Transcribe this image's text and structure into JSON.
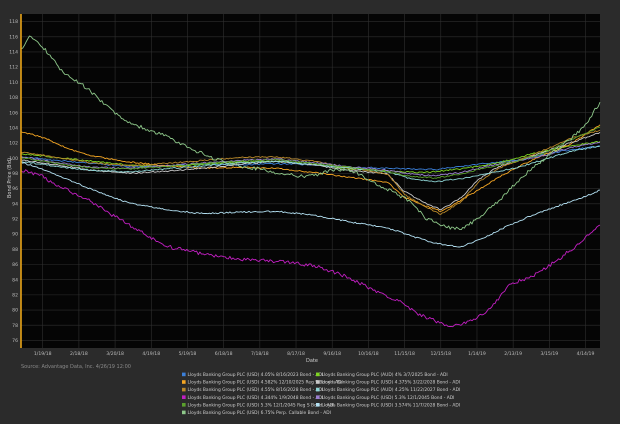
{
  "chart_data": {
    "type": "line",
    "xlabel": "Date",
    "ylabel": "Bond Price (Bid)",
    "source": "Source: Advantage Data, Inc. 4/26/19 12:00",
    "x_start": "2018-01-01",
    "x_end": "2019-04-26",
    "x_ticks": [
      {
        "date": "2018-01-19",
        "label": "1/19/18"
      },
      {
        "date": "2018-02-18",
        "label": "2/18/18"
      },
      {
        "date": "2018-03-20",
        "label": "3/20/18"
      },
      {
        "date": "2018-04-19",
        "label": "4/19/18"
      },
      {
        "date": "2018-05-19",
        "label": "5/19/18"
      },
      {
        "date": "2018-06-18",
        "label": "6/18/18"
      },
      {
        "date": "2018-07-18",
        "label": "7/18/18"
      },
      {
        "date": "2018-08-17",
        "label": "8/17/18"
      },
      {
        "date": "2018-09-16",
        "label": "9/16/18"
      },
      {
        "date": "2018-10-16",
        "label": "10/16/18"
      },
      {
        "date": "2018-11-15",
        "label": "11/15/18"
      },
      {
        "date": "2018-12-15",
        "label": "12/15/18"
      },
      {
        "date": "2019-01-14",
        "label": "1/14/19"
      },
      {
        "date": "2019-02-13",
        "label": "2/13/19"
      },
      {
        "date": "2019-03-15",
        "label": "3/15/19"
      },
      {
        "date": "2019-04-14",
        "label": "4/14/19"
      }
    ],
    "ylim": [
      75,
      119
    ],
    "y_ticks": [
      76,
      78,
      80,
      82,
      84,
      86,
      88,
      90,
      92,
      94,
      96,
      98,
      100,
      102,
      104,
      106,
      108,
      110,
      112,
      114,
      116,
      118
    ],
    "grid": true,
    "legend_position": "bottom",
    "series": [
      {
        "name": "Lloyds Banking Group PLC (USD) 4.05% 8/16/2023 Bond - ADI",
        "color": "#3b7fd9",
        "x": [
          "2018-01-01",
          "2018-02-01",
          "2018-03-01",
          "2018-04-01",
          "2018-05-01",
          "2018-06-01",
          "2018-07-01",
          "2018-08-01",
          "2018-09-01",
          "2018-10-01",
          "2018-11-01",
          "2018-11-20",
          "2018-12-10",
          "2018-12-31",
          "2019-01-20",
          "2019-02-15",
          "2019-03-10",
          "2019-04-01",
          "2019-04-26"
        ],
        "y": [
          100.2,
          99.7,
          99.3,
          98.9,
          99.0,
          99.2,
          99.1,
          99.3,
          99.1,
          98.8,
          98.7,
          98.6,
          98.5,
          98.9,
          99.3,
          99.7,
          100.5,
          101.1,
          101.6
        ]
      },
      {
        "name": "Lloyds Banking Group PLC (AUD) 4% 3/7/2025 Bond - ADI",
        "color": "#7ed321",
        "x": [
          "2018-01-01",
          "2018-02-01",
          "2018-03-01",
          "2018-04-01",
          "2018-05-01",
          "2018-06-01",
          "2018-07-01",
          "2018-08-01",
          "2018-09-01",
          "2018-10-01",
          "2018-11-01",
          "2018-12-01",
          "2019-01-01",
          "2019-02-01",
          "2019-03-01",
          "2019-04-01",
          "2019-04-26"
        ],
        "y": [
          100.6,
          100.1,
          99.6,
          99.1,
          98.9,
          99.2,
          99.5,
          99.6,
          99.2,
          98.6,
          98.3,
          98.1,
          98.6,
          99.4,
          100.6,
          101.6,
          102.2
        ]
      },
      {
        "name": "Lloyds Banking Group PLC (USD) 4.582% 12/10/2025 Reg S Bond - ADI",
        "color": "#f5a623",
        "x": [
          "2018-01-01",
          "2018-01-20",
          "2018-02-10",
          "2018-03-01",
          "2018-04-01",
          "2018-05-01",
          "2018-06-01",
          "2018-07-01",
          "2018-08-01",
          "2018-09-01",
          "2018-10-01",
          "2018-11-01",
          "2018-11-15",
          "2018-12-01",
          "2018-12-15",
          "2019-01-01",
          "2019-01-15",
          "2019-02-01",
          "2019-03-01",
          "2019-04-01",
          "2019-04-26"
        ],
        "y": [
          103.5,
          102.7,
          101.2,
          100.3,
          99.5,
          99.0,
          98.7,
          98.8,
          98.7,
          98.1,
          97.5,
          96.8,
          94.8,
          93.8,
          93.0,
          94.5,
          95.8,
          97.5,
          99.8,
          101.8,
          104.4
        ]
      },
      {
        "name": "Lloyds Banking Group PLC (USD) 4.375% 3/22/2028 Bond - ADI",
        "color": "#c9c9c9",
        "x": [
          "2018-01-01",
          "2018-02-01",
          "2018-03-01",
          "2018-04-01",
          "2018-05-01",
          "2018-06-01",
          "2018-07-01",
          "2018-08-01",
          "2018-09-01",
          "2018-10-01",
          "2018-11-01",
          "2018-11-15",
          "2018-12-01",
          "2018-12-15",
          "2019-01-01",
          "2019-01-15",
          "2019-02-01",
          "2019-03-01",
          "2019-04-01",
          "2019-04-26"
        ],
        "y": [
          99.8,
          99.1,
          98.4,
          98.0,
          98.3,
          98.7,
          99.2,
          99.6,
          99.1,
          98.4,
          97.9,
          95.6,
          94.2,
          93.2,
          94.8,
          97.2,
          98.9,
          100.3,
          102.0,
          103.4
        ]
      },
      {
        "name": "Lloyds Banking Group PLC (USD) 4.55% 8/16/2028 Bond - ADI",
        "color": "#b8882a",
        "x": [
          "2018-01-01",
          "2018-02-01",
          "2018-03-01",
          "2018-04-01",
          "2018-05-01",
          "2018-06-01",
          "2018-07-01",
          "2018-08-01",
          "2018-09-01",
          "2018-10-01",
          "2018-11-01",
          "2018-11-15",
          "2018-12-01",
          "2018-12-15",
          "2019-01-01",
          "2019-01-15",
          "2019-02-01",
          "2019-03-01",
          "2019-04-01",
          "2019-04-26"
        ],
        "y": [
          100.8,
          100.1,
          99.4,
          99.0,
          99.3,
          99.7,
          100.1,
          100.2,
          99.6,
          98.7,
          97.9,
          95.2,
          93.7,
          92.6,
          94.3,
          96.8,
          98.7,
          100.4,
          102.6,
          103.7
        ]
      },
      {
        "name": "Lloyds Banking Group PLC (AUD) 4.25% 11/22/2027 Bond - ADI",
        "color": "#8fd6d6",
        "x": [
          "2018-01-01",
          "2018-02-01",
          "2018-03-01",
          "2018-04-01",
          "2018-05-01",
          "2018-06-01",
          "2018-07-01",
          "2018-08-01",
          "2018-09-01",
          "2018-10-01",
          "2018-11-01",
          "2018-11-20",
          "2018-12-10",
          "2018-12-31",
          "2019-01-20",
          "2019-02-15",
          "2019-03-10",
          "2019-04-01",
          "2019-04-26"
        ],
        "y": [
          99.6,
          98.9,
          98.4,
          98.2,
          98.6,
          99.0,
          99.4,
          99.6,
          99.2,
          98.7,
          98.2,
          97.3,
          96.9,
          97.3,
          97.9,
          98.7,
          99.8,
          100.9,
          101.6
        ]
      },
      {
        "name": "Lloyds Banking Group PLC (USD) 4.344% 1/9/2048 Bond - ADI",
        "color": "#c21fc2",
        "x": [
          "2018-01-01",
          "2018-01-15",
          "2018-02-01",
          "2018-03-01",
          "2018-03-20",
          "2018-04-10",
          "2018-05-01",
          "2018-06-01",
          "2018-07-01",
          "2018-08-01",
          "2018-09-01",
          "2018-10-01",
          "2018-10-20",
          "2018-11-10",
          "2018-11-25",
          "2018-12-10",
          "2018-12-25",
          "2019-01-10",
          "2019-01-25",
          "2019-02-10",
          "2019-03-01",
          "2019-03-20",
          "2019-04-10",
          "2019-04-26"
        ],
        "y": [
          98.4,
          97.9,
          96.4,
          94.2,
          92.3,
          90.4,
          88.4,
          87.4,
          86.7,
          86.4,
          85.9,
          84.2,
          82.6,
          81.2,
          79.6,
          78.6,
          77.8,
          78.6,
          80.2,
          83.4,
          84.4,
          86.4,
          88.9,
          91.2
        ]
      },
      {
        "name": "Lloyds Banking Group PLC (USD) 5.3% 12/1/2045 Bond - ADI",
        "color": "#9b7fd0",
        "x": [
          "2018-01-01",
          "2018-02-01",
          "2018-03-01",
          "2018-04-01",
          "2018-05-01",
          "2018-06-01",
          "2018-07-01",
          "2018-08-01",
          "2018-09-01",
          "2018-10-01",
          "2018-11-01",
          "2018-11-20",
          "2018-12-10",
          "2018-12-31",
          "2019-01-20",
          "2019-02-15",
          "2019-03-10",
          "2019-04-01",
          "2019-04-26"
        ],
        "y": [
          100.2,
          99.4,
          98.8,
          98.7,
          99.0,
          99.4,
          99.7,
          99.9,
          99.4,
          98.9,
          98.4,
          97.9,
          97.7,
          98.1,
          98.9,
          99.6,
          100.3,
          101.4,
          102.1
        ]
      },
      {
        "name": "Lloyds Banking Group PLC (USD) 5.3% 12/1/2045 Reg S Bond - ADI",
        "color": "#5aa02c",
        "x": [
          "2018-01-01",
          "2018-02-01",
          "2018-03-01",
          "2018-04-01",
          "2018-05-01",
          "2018-06-01",
          "2018-07-01",
          "2018-08-01",
          "2018-09-01",
          "2018-10-01",
          "2018-11-01",
          "2018-11-20",
          "2018-12-10",
          "2018-12-31",
          "2019-01-20",
          "2019-02-15",
          "2019-03-10",
          "2019-04-01",
          "2019-04-26"
        ],
        "y": [
          100.1,
          99.3,
          98.7,
          98.6,
          98.9,
          99.3,
          99.6,
          99.8,
          99.3,
          98.8,
          98.2,
          97.6,
          97.4,
          97.9,
          98.7,
          99.6,
          100.6,
          102.4,
          104.1
        ]
      },
      {
        "name": "Lloyds Banking Group PLC (USD) 3.574% 11/7/2028 Bond - ADI",
        "color": "#b3e0f2",
        "x": [
          "2018-01-01",
          "2018-01-25",
          "2018-02-15",
          "2018-03-10",
          "2018-04-01",
          "2018-05-01",
          "2018-06-01",
          "2018-07-01",
          "2018-08-01",
          "2018-09-01",
          "2018-10-01",
          "2018-11-01",
          "2018-11-20",
          "2018-12-10",
          "2018-12-31",
          "2019-01-20",
          "2019-02-10",
          "2019-03-01",
          "2019-03-20",
          "2019-04-10",
          "2019-04-26"
        ],
        "y": [
          99.5,
          98.2,
          96.8,
          95.3,
          94.1,
          93.2,
          92.7,
          92.9,
          93.0,
          92.5,
          91.6,
          90.8,
          89.8,
          88.8,
          88.3,
          89.5,
          91.2,
          92.5,
          93.6,
          94.7,
          95.8
        ]
      },
      {
        "name": "Lloyds Banking Group PLC (USD) 6.75% Perp. Callable Bond - ADI",
        "color": "#8ec88a",
        "x": [
          "2018-01-01",
          "2018-01-08",
          "2018-01-15",
          "2018-01-25",
          "2018-02-05",
          "2018-02-20",
          "2018-03-05",
          "2018-03-20",
          "2018-04-05",
          "2018-04-20",
          "2018-05-05",
          "2018-05-20",
          "2018-06-05",
          "2018-06-20",
          "2018-07-05",
          "2018-07-20",
          "2018-08-05",
          "2018-08-20",
          "2018-09-05",
          "2018-09-20",
          "2018-10-05",
          "2018-10-20",
          "2018-11-05",
          "2018-11-20",
          "2018-12-01",
          "2018-12-15",
          "2019-01-01",
          "2019-01-15",
          "2019-02-01",
          "2019-02-15",
          "2019-03-01",
          "2019-03-15",
          "2019-04-01",
          "2019-04-15",
          "2019-04-26"
        ],
        "y": [
          114.4,
          116.1,
          115.3,
          113.6,
          111.3,
          109.8,
          108.1,
          105.8,
          104.4,
          103.6,
          102.6,
          101.4,
          100.3,
          99.4,
          98.9,
          98.5,
          98.0,
          97.6,
          97.9,
          98.6,
          98.2,
          96.9,
          95.6,
          94.3,
          92.3,
          91.1,
          90.6,
          92.1,
          94.4,
          96.6,
          98.8,
          100.4,
          102.4,
          104.6,
          107.4
        ]
      }
    ]
  }
}
